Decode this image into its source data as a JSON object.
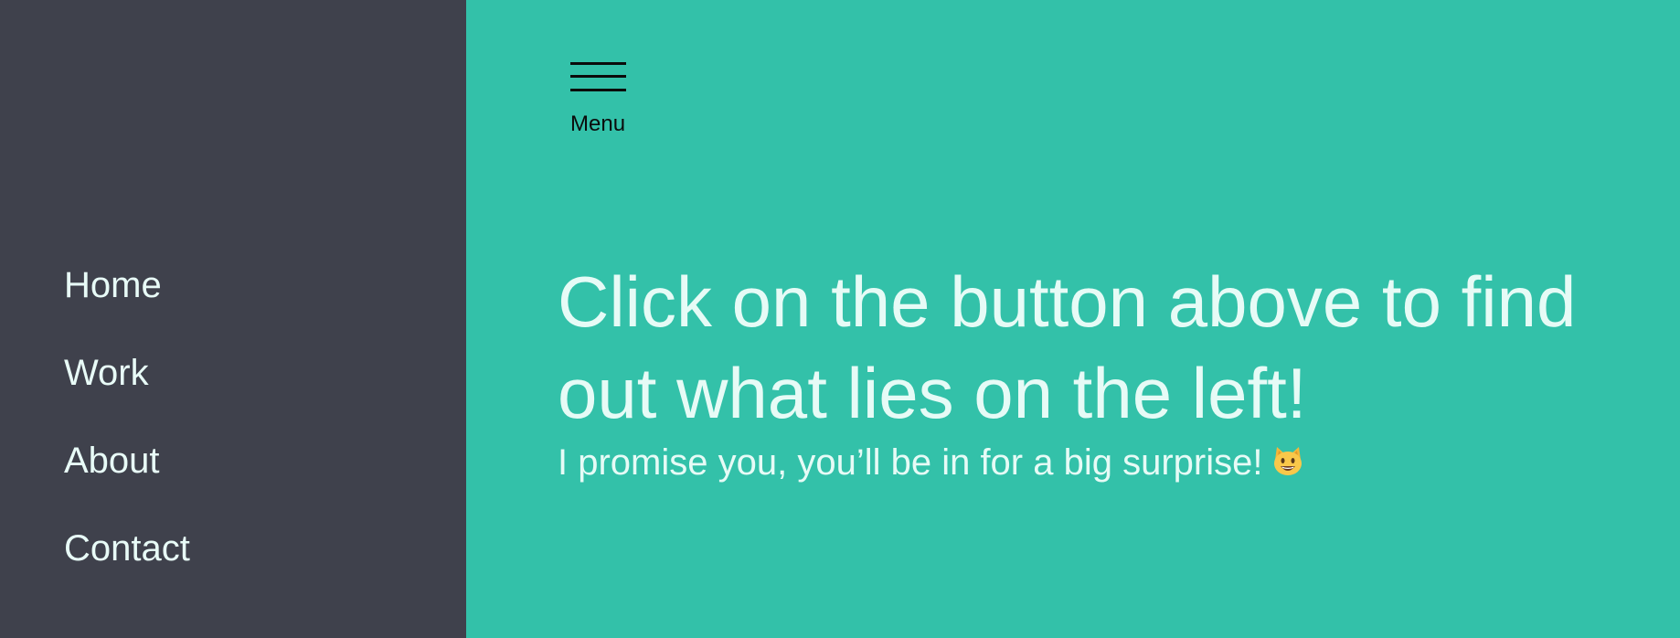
{
  "sidebar": {
    "background": "#3f414c",
    "items": [
      {
        "label": "Home"
      },
      {
        "label": "Work"
      },
      {
        "label": "About"
      },
      {
        "label": "Contact"
      }
    ]
  },
  "main": {
    "background": "#33c1a9",
    "menu_button": {
      "icon": "hamburger-menu-icon",
      "label": "Menu"
    },
    "headline": "Click on the button above to find out what lies on the left!",
    "subline": "I promise you, you’ll be in for a big surprise!",
    "subline_emoji": "grinning-cat-icon"
  }
}
